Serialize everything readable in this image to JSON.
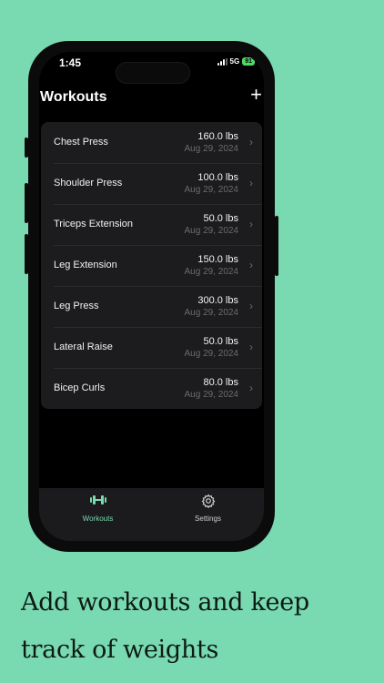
{
  "status_bar": {
    "time": "1:45",
    "network": "5G",
    "battery": "91"
  },
  "header": {
    "title": "Workouts",
    "add_label": "+"
  },
  "workouts": [
    {
      "name": "Chest Press",
      "weight": "160.0 lbs",
      "date": "Aug 29, 2024"
    },
    {
      "name": "Shoulder Press",
      "weight": "100.0 lbs",
      "date": "Aug 29, 2024"
    },
    {
      "name": "Triceps Extension",
      "weight": "50.0 lbs",
      "date": "Aug 29, 2024"
    },
    {
      "name": "Leg Extension",
      "weight": "150.0 lbs",
      "date": "Aug 29, 2024"
    },
    {
      "name": "Leg Press",
      "weight": "300.0 lbs",
      "date": "Aug 29, 2024"
    },
    {
      "name": "Lateral Raise",
      "weight": "50.0 lbs",
      "date": "Aug 29, 2024"
    },
    {
      "name": "Bicep Curls",
      "weight": "80.0 lbs",
      "date": "Aug 29, 2024"
    }
  ],
  "tabs": [
    {
      "label": "Workouts",
      "icon": "dumbbell-icon",
      "active": true
    },
    {
      "label": "Settings",
      "icon": "gear-icon",
      "active": false
    }
  ],
  "caption": {
    "line1": "Add workouts and keep",
    "line2": "track of weights"
  },
  "colors": {
    "background": "#79d9b0",
    "accent": "#79d9b0",
    "list_bg": "#1c1c1e"
  }
}
